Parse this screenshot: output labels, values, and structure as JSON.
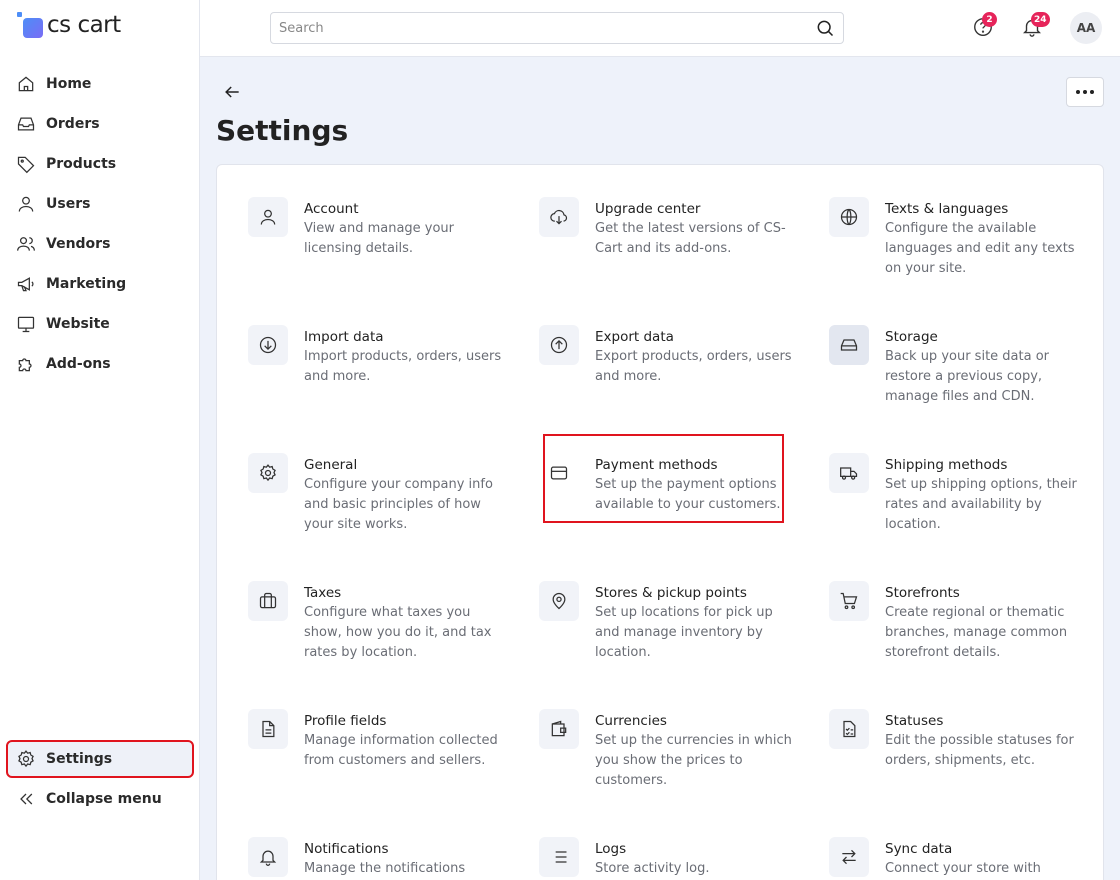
{
  "app": {
    "logo_text": "cs cart"
  },
  "sidebar": {
    "items": [
      {
        "label": "Home",
        "icon": "home-icon"
      },
      {
        "label": "Orders",
        "icon": "inbox-icon"
      },
      {
        "label": "Products",
        "icon": "tag-icon"
      },
      {
        "label": "Users",
        "icon": "user-icon"
      },
      {
        "label": "Vendors",
        "icon": "users-icon"
      },
      {
        "label": "Marketing",
        "icon": "megaphone-icon"
      },
      {
        "label": "Website",
        "icon": "monitor-icon"
      },
      {
        "label": "Add-ons",
        "icon": "puzzle-icon"
      }
    ],
    "settings_label": "Settings",
    "collapse_label": "Collapse menu"
  },
  "header": {
    "search_placeholder": "Search",
    "help_badge": "2",
    "notifications_badge": "24",
    "avatar_initials": "AA"
  },
  "main": {
    "title": "Settings",
    "items": [
      {
        "title": "Account",
        "desc": "View and manage your licensing details.",
        "icon": "user-icon"
      },
      {
        "title": "Upgrade center",
        "desc": "Get the latest versions of CS-Cart and its add-ons.",
        "icon": "cloud-download-icon"
      },
      {
        "title": "Texts & languages",
        "desc": "Configure the available languages and edit any texts on your site.",
        "icon": "globe-icon"
      },
      {
        "title": "Import data",
        "desc": "Import products, orders, users and more.",
        "icon": "arrow-down-circle-icon"
      },
      {
        "title": "Export data",
        "desc": "Export products, orders, users and more.",
        "icon": "arrow-up-circle-icon"
      },
      {
        "title": "Storage",
        "desc": "Back up your site data or restore a previous copy, manage files and CDN.",
        "icon": "hard-drive-icon"
      },
      {
        "title": "General",
        "desc": "Configure your company info and basic principles of how your site works.",
        "icon": "gear-icon"
      },
      {
        "title": "Payment methods",
        "desc": "Set up the payment options available to your customers.",
        "icon": "credit-card-icon"
      },
      {
        "title": "Shipping methods",
        "desc": "Set up shipping options, their rates and availability by location.",
        "icon": "truck-icon"
      },
      {
        "title": "Taxes",
        "desc": "Configure what taxes you show, how you do it, and tax rates by location.",
        "icon": "briefcase-icon"
      },
      {
        "title": "Stores & pickup points",
        "desc": "Set up locations for pick up and manage inventory by location.",
        "icon": "map-pin-icon"
      },
      {
        "title": "Storefronts",
        "desc": "Create regional or thematic branches, manage common storefront details.",
        "icon": "cart-icon"
      },
      {
        "title": "Profile fields",
        "desc": "Manage information collected from customers and sellers.",
        "icon": "file-text-icon"
      },
      {
        "title": "Currencies",
        "desc": "Set up the currencies in which you show the prices to customers.",
        "icon": "wallet-icon"
      },
      {
        "title": "Statuses",
        "desc": "Edit the possible statuses for orders, shipments, etc.",
        "icon": "checklist-icon"
      },
      {
        "title": "Notifications",
        "desc": "Manage the notifications",
        "icon": "bell-icon"
      },
      {
        "title": "Logs",
        "desc": "Store activity log.",
        "icon": "list-icon"
      },
      {
        "title": "Sync data",
        "desc": "Connect your store with",
        "icon": "arrows-swap-icon"
      }
    ]
  }
}
